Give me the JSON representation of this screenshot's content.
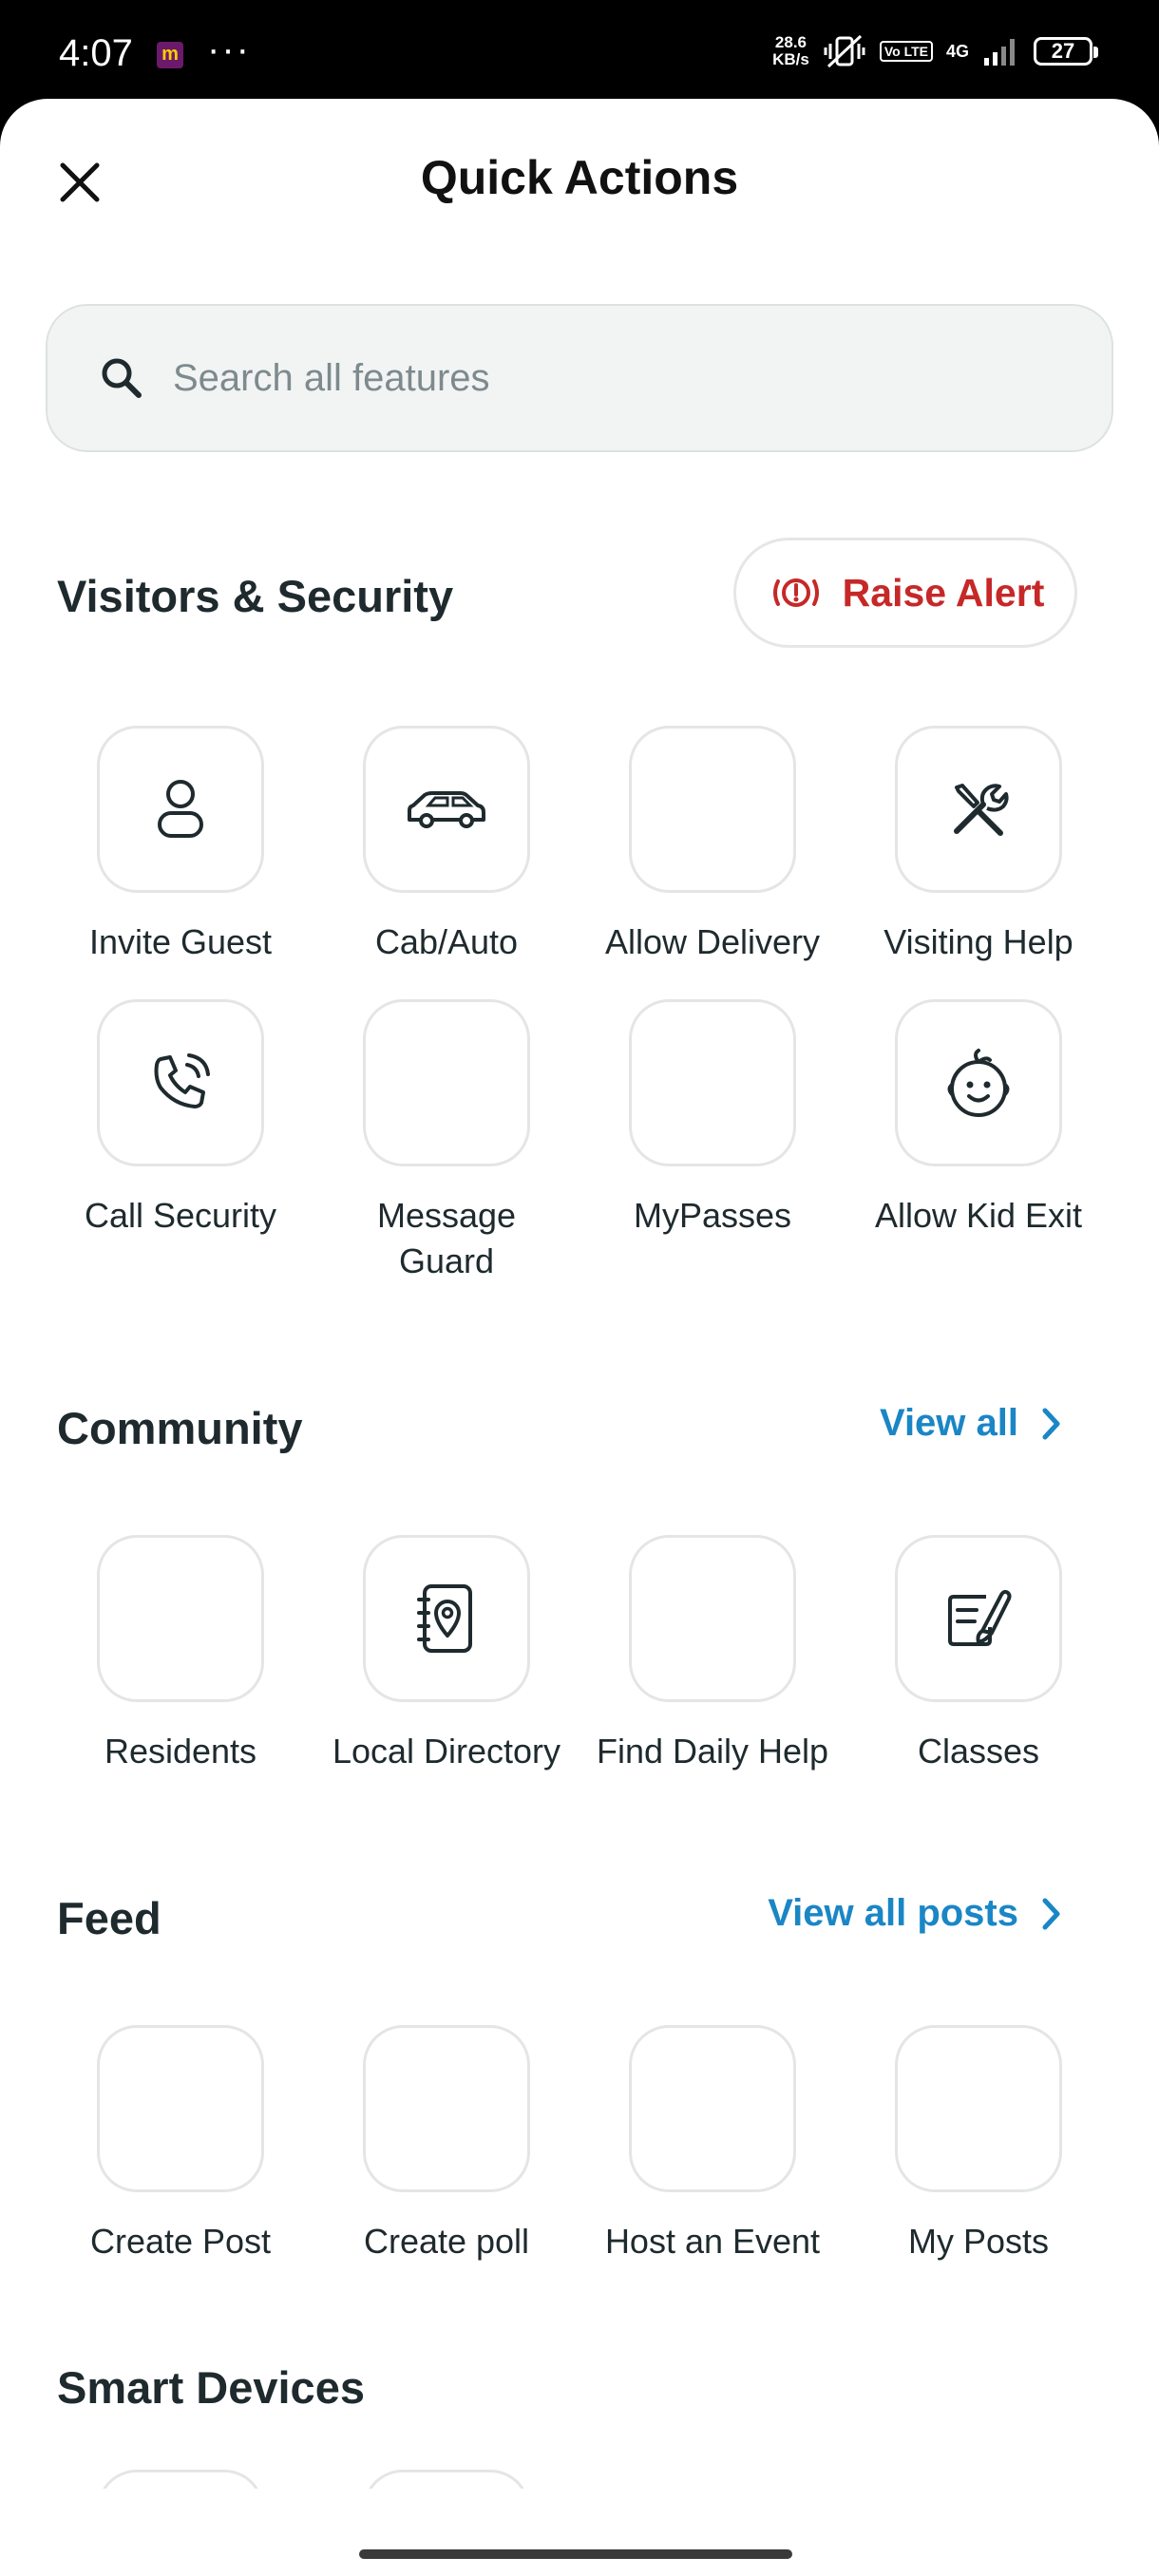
{
  "status_bar": {
    "time": "4:07",
    "app_badge": "m",
    "overflow": "···",
    "net_speed_top": "28.6",
    "net_speed_bottom": "KB/s",
    "volte": "Vo LTE",
    "network": "4G",
    "battery": "27"
  },
  "header": {
    "title": "Quick Actions",
    "close_icon": "close-icon"
  },
  "search": {
    "placeholder": "Search all features",
    "value": ""
  },
  "visitors": {
    "title": "Visitors & Security",
    "raise_alert": "Raise Alert",
    "alert_color": "#c62828",
    "items": [
      {
        "label": "Invite Guest",
        "icon": "person-icon"
      },
      {
        "label": "Cab/Auto",
        "icon": "car-icon"
      },
      {
        "label": "Allow Delivery",
        "icon": ""
      },
      {
        "label": "Visiting Help",
        "icon": "tools-icon"
      },
      {
        "label": "Call Security",
        "icon": "phone-icon"
      },
      {
        "label": "Message Guard",
        "icon": ""
      },
      {
        "label": "MyPasses",
        "icon": ""
      },
      {
        "label": "Allow Kid Exit",
        "icon": "baby-icon"
      }
    ]
  },
  "community": {
    "title": "Community",
    "view_all": "View all",
    "link_color": "#1a86c5",
    "items": [
      {
        "label": "Residents",
        "icon": ""
      },
      {
        "label": "Local Directory",
        "icon": "directory-icon"
      },
      {
        "label": "Find Daily Help",
        "icon": ""
      },
      {
        "label": "Classes",
        "icon": "classes-icon"
      }
    ]
  },
  "feed": {
    "title": "Feed",
    "view_all": "View all posts",
    "items": [
      {
        "label": "Create Post",
        "icon": ""
      },
      {
        "label": "Create poll",
        "icon": ""
      },
      {
        "label": "Host an Event",
        "icon": ""
      },
      {
        "label": "My Posts",
        "icon": ""
      }
    ]
  },
  "smart_devices": {
    "title": "Smart Devices"
  }
}
